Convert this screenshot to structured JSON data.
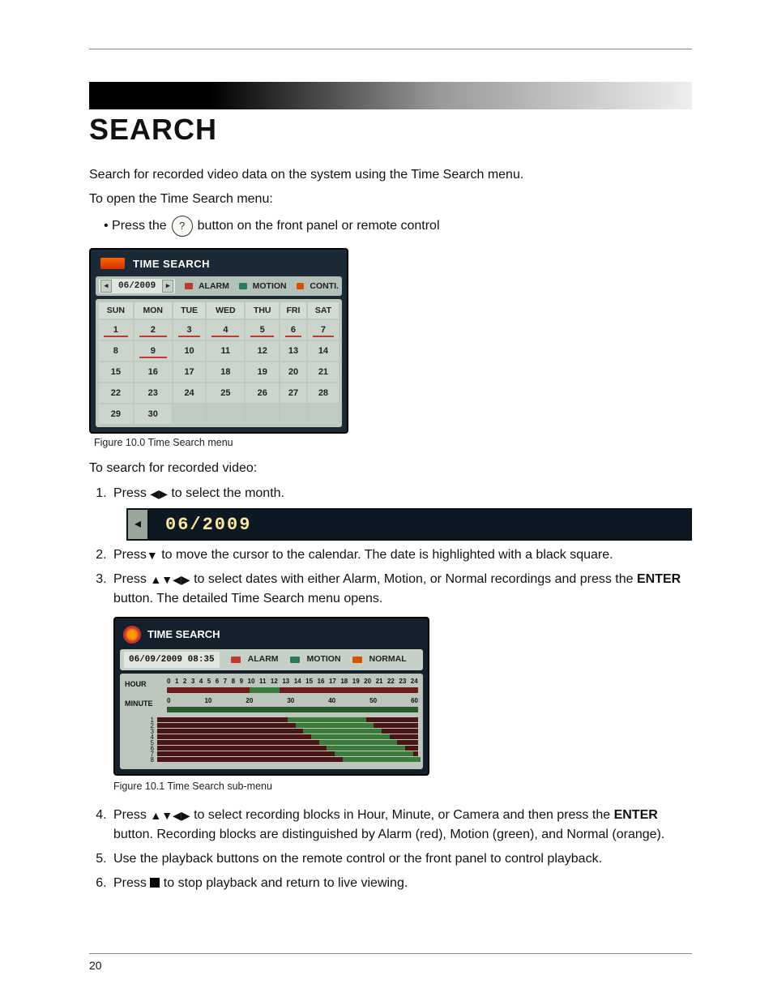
{
  "page_number": "20",
  "heading": "SEARCH",
  "intro": "Search for recorded video data on the system using the Time Search menu.",
  "open_menu_lead": "To open the Time Search menu:",
  "bullet": {
    "prefix": "• Press the ",
    "icon_glyph": "?",
    "suffix": " button on the front panel or remote control"
  },
  "figure100": {
    "title": "TIME SEARCH",
    "month": "06/2009",
    "legend": {
      "alarm": "ALARM",
      "motion": "MOTION",
      "conti": "CONTI."
    },
    "weekdays": [
      "SUN",
      "MON",
      "TUE",
      "WED",
      "THU",
      "FRI",
      "SAT"
    ],
    "rows": [
      [
        {
          "n": "1",
          "rec": true
        },
        {
          "n": "2",
          "rec": true
        },
        {
          "n": "3",
          "rec": true
        },
        {
          "n": "4",
          "rec": true
        },
        {
          "n": "5",
          "rec": true
        },
        {
          "n": "6",
          "rec": true
        },
        {
          "n": "7",
          "rec": true
        }
      ],
      [
        {
          "n": "8",
          "rec": false
        },
        {
          "n": "9",
          "rec": true
        },
        {
          "n": "10",
          "rec": false
        },
        {
          "n": "11",
          "rec": false
        },
        {
          "n": "12",
          "rec": false
        },
        {
          "n": "13",
          "rec": false
        },
        {
          "n": "14",
          "rec": false
        }
      ],
      [
        {
          "n": "15",
          "rec": false
        },
        {
          "n": "16",
          "rec": false
        },
        {
          "n": "17",
          "rec": false
        },
        {
          "n": "18",
          "rec": false
        },
        {
          "n": "19",
          "rec": false
        },
        {
          "n": "20",
          "rec": false
        },
        {
          "n": "21",
          "rec": false
        }
      ],
      [
        {
          "n": "22",
          "rec": false
        },
        {
          "n": "23",
          "rec": false
        },
        {
          "n": "24",
          "rec": false
        },
        {
          "n": "25",
          "rec": false
        },
        {
          "n": "26",
          "rec": false
        },
        {
          "n": "27",
          "rec": false
        },
        {
          "n": "28",
          "rec": false
        }
      ],
      [
        {
          "n": "29",
          "rec": false
        },
        {
          "n": "30",
          "rec": false
        },
        {
          "n": "",
          "rec": false
        },
        {
          "n": "",
          "rec": false
        },
        {
          "n": "",
          "rec": false
        },
        {
          "n": "",
          "rec": false
        },
        {
          "n": "",
          "rec": false
        }
      ]
    ],
    "caption": "Figure 10.0 Time Search menu"
  },
  "search_lead": "To search for recorded video:",
  "step1": {
    "pre": "Press ",
    "post": " to select the month."
  },
  "month_zoom": "06/2009",
  "step2": {
    "pre": "Press",
    "post": " to move the cursor to the calendar. The date is highlighted with a black square."
  },
  "step3": {
    "pre": "Press ",
    "mid": " to select dates with either Alarm, Motion, or Normal recordings and press the ",
    "enter": "ENTER",
    "post": " button. The detailed Time Search menu opens."
  },
  "figure101": {
    "title": "TIME SEARCH",
    "datetime": "06/09/2009 08:35",
    "legend": {
      "alarm": "ALARM",
      "motion": "MOTION",
      "normal": "NORMAL"
    },
    "hour_label": "HOUR",
    "hour_ticks": [
      "0",
      "1",
      "2",
      "3",
      "4",
      "5",
      "6",
      "7",
      "8",
      "9",
      "10",
      "11",
      "12",
      "13",
      "14",
      "15",
      "16",
      "17",
      "18",
      "19",
      "20",
      "21",
      "22",
      "23",
      "24"
    ],
    "minute_label": "MINUTE",
    "minute_ticks": [
      "0",
      "10",
      "20",
      "30",
      "40",
      "50",
      "60"
    ],
    "camera_labels": [
      "1",
      "2",
      "3",
      "4",
      "5",
      "6",
      "7",
      "8"
    ],
    "caption": "Figure 10.1 Time Search sub-menu"
  },
  "step4": {
    "pre": "Press ",
    "mid": " to select recording blocks in Hour, Minute, or Camera and then press the ",
    "enter": "ENTER",
    "post": " button. Recording blocks are distinguished by Alarm (red), Motion (green), and Normal (orange)."
  },
  "step5": "Use the playback buttons on the remote control or the front panel to control playback.",
  "step6": {
    "pre": "Press ",
    "post": " to stop playback and return to live viewing."
  }
}
